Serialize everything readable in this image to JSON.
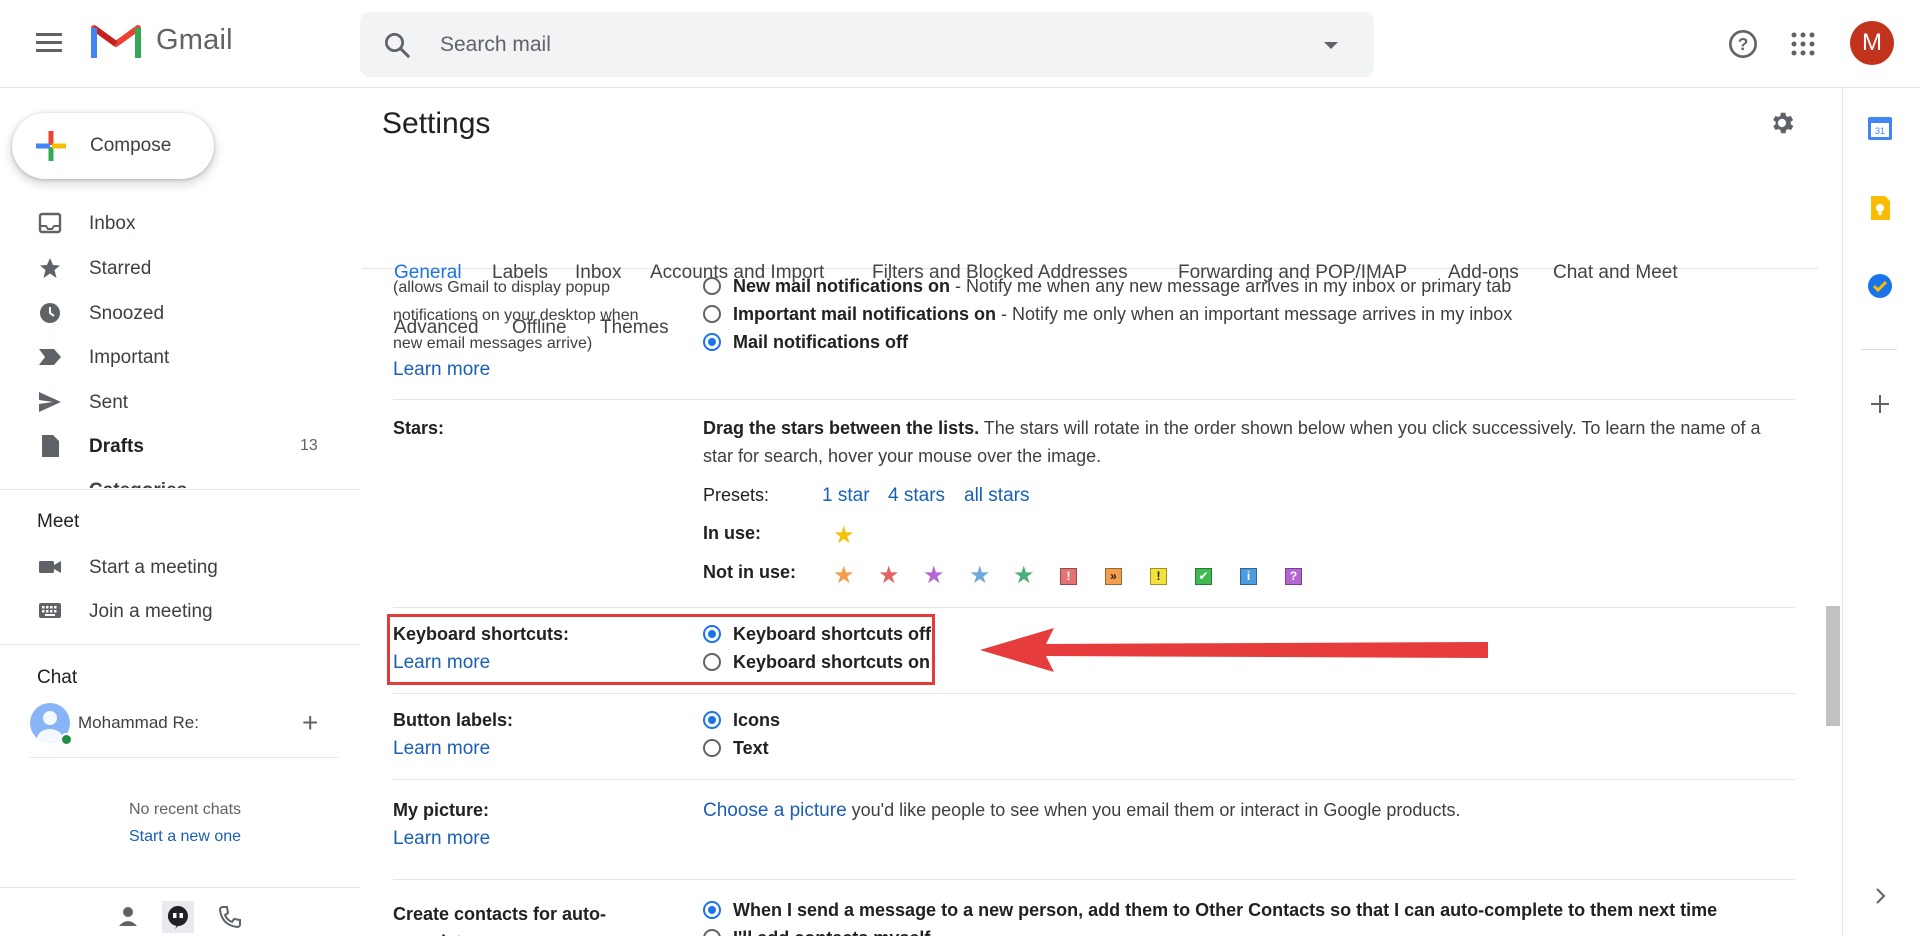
{
  "header": {
    "app_name": "Gmail",
    "search_placeholder": "Search mail",
    "avatar_letter": "M"
  },
  "nav": {
    "compose_label": "Compose",
    "items": [
      {
        "label": "Inbox",
        "icon": "inbox-icon"
      },
      {
        "label": "Starred",
        "icon": "star-icon"
      },
      {
        "label": "Snoozed",
        "icon": "clock-icon"
      },
      {
        "label": "Important",
        "icon": "important-icon"
      },
      {
        "label": "Sent",
        "icon": "send-icon"
      },
      {
        "label": "Drafts",
        "icon": "draft-icon",
        "count": "13"
      }
    ],
    "cut_item": "Categories",
    "meet": {
      "title": "Meet",
      "start": "Start a meeting",
      "join": "Join a meeting"
    },
    "chat": {
      "title": "Chat",
      "user": "Mohammad Re:",
      "no_recent": "No recent chats",
      "start_new": "Start a new one"
    }
  },
  "settings": {
    "title": "Settings",
    "tabs_row1": [
      "General",
      "Labels",
      "Inbox",
      "Accounts and Import",
      "Filters and Blocked Addresses",
      "Forwarding and POP/IMAP",
      "Add-ons",
      "Chat and Meet"
    ],
    "tabs_row2": [
      "Advanced",
      "Offline",
      "Themes"
    ],
    "active_tab": "General",
    "desktop_notifications": {
      "sub_line1": "(allows Gmail to display popup",
      "sub_line2": "notifications on your desktop when",
      "sub_line3": "new email messages arrive)",
      "learn_more": "Learn more",
      "options": [
        {
          "bold": "New mail notifications on",
          "rest": " - Notify me when any new message arrives in my inbox or primary tab",
          "selected": false
        },
        {
          "bold": "Important mail notifications on",
          "rest": " - Notify me only when an important message arrives in my inbox",
          "selected": false
        },
        {
          "bold": "Mail notifications off",
          "rest": "",
          "selected": true
        }
      ]
    },
    "stars": {
      "label": "Stars:",
      "text_bold": "Drag the stars between the lists.",
      "text_rest": "  The stars will rotate in the order shown below when you click successively. To learn the name of a star for search, hover your mouse over the image.",
      "presets_label": "Presets:",
      "presets": [
        "1 star",
        "4 stars",
        "all stars"
      ],
      "in_use_label": "In use:",
      "not_in_use_label": "Not in use:",
      "colors": {
        "yellow": "#f4c20d",
        "orange": "#f29e4c",
        "red": "#e06666",
        "purple": "#b666d2",
        "blue": "#6fa8dc",
        "green": "#4caf78"
      },
      "marks": [
        "!",
        "»",
        "!",
        "✔",
        "i",
        "?"
      ]
    },
    "keyboard_shortcuts": {
      "label": "Keyboard shortcuts:",
      "learn_more": "Learn more",
      "off": "Keyboard shortcuts off",
      "on": "Keyboard shortcuts on"
    },
    "button_labels": {
      "label": "Button labels:",
      "learn_more": "Learn more",
      "icons": "Icons",
      "text": "Text"
    },
    "my_picture": {
      "label": "My picture:",
      "learn_more": "Learn more",
      "link": "Choose a picture",
      "rest": " you'd like people to see when you email them or interact in Google products."
    },
    "create_contacts": {
      "label_line1": "Create contacts for auto-",
      "label_line2": "complete:",
      "opt1": "When I send a message to a new person, add them to Other Contacts so that I can auto-complete to them next time",
      "opt2": "I'll add contacts myself"
    }
  }
}
